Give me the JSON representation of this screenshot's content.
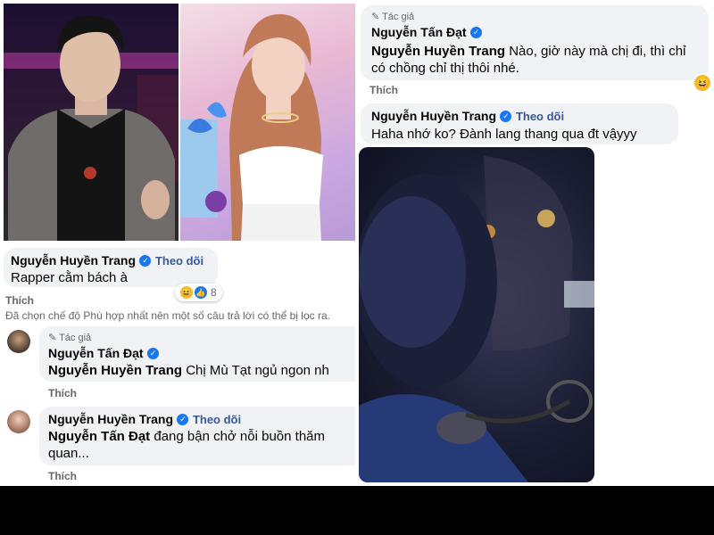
{
  "colors": {
    "accent": "#1877f2",
    "follow": "#385898",
    "bubble": "#f0f2f5",
    "like": "#65676b"
  },
  "comment_left_1": {
    "author": "Nguyễn Huyền Trang",
    "follow": "Theo dõi",
    "text": "Rapper cằm bách à",
    "reaction_count": "8",
    "like": "Thích"
  },
  "notice": "Đã chọn chế độ Phù hợp nhất nên một số câu trả lời có thể bị lọc ra.",
  "comment_left_2": {
    "tag": "Tác giả",
    "author": "Nguyễn Tấn Đạt",
    "mention": "Nguyễn Huyền Trang",
    "text": " Chị Mù Tạt ngủ ngon nh",
    "like": "Thích"
  },
  "comment_left_3": {
    "author": "Nguyễn Huyền Trang",
    "follow": "Theo dõi",
    "mention": "Nguyễn Tấn Đạt",
    "text": " đang bận chở nỗi buồn thăm quan...",
    "like": "Thích"
  },
  "comment_right_1": {
    "tag": "Tác giả",
    "author": "Nguyễn Tấn Đạt",
    "mention": "Nguyễn Huyền Trang",
    "text": " Nào, giờ này mà chị đi, thì chỉ có chồng chỉ thị thôi nhé.",
    "like": "Thích"
  },
  "comment_right_2": {
    "author": "Nguyễn Huyền Trang",
    "follow": "Theo dõi",
    "text": "Haha nhớ ko? Đành lang thang qua đt vậyyy"
  },
  "icons": {
    "verified": "verified-badge-icon",
    "author_tag": "pen-icon",
    "haha": "haha-reaction-icon",
    "like": "like-reaction-icon"
  }
}
